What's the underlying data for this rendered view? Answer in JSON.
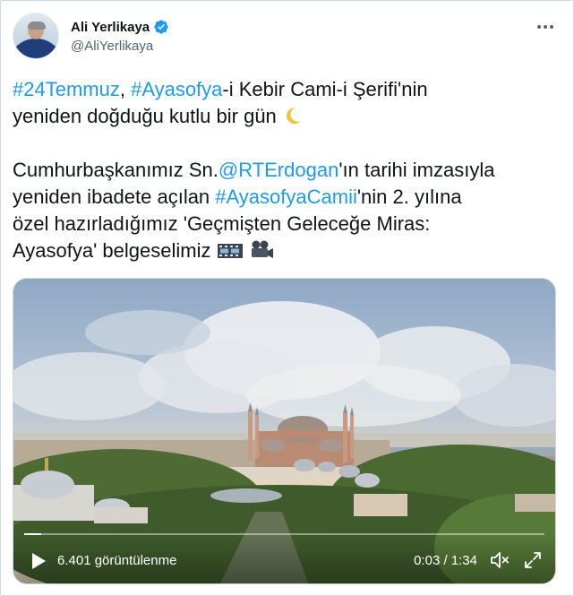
{
  "author": {
    "display_name": "Ali Yerlikaya",
    "handle": "@AliYerlikaya",
    "verified": true
  },
  "tweet": {
    "hashtag_1": "#24Temmuz",
    "sep_1": ", ",
    "hashtag_2": "#Ayasofya",
    "text_1": "-i Kebir Cami-i Şerifi'nin\nyeniden doğduğu kutlu bir gün ",
    "text_2": "\n\nCumhurbaşkanımız Sn.",
    "mention": "@RTErdogan",
    "text_3": "'ın tarihi imzasıyla\nyeniden ibadete açılan ",
    "hashtag_3": "#AyasofyaCamii",
    "text_4": "'nin 2. yılına\nözel hazırladığımız 'Geçmişten Geleceğe Miras:\nAyasofya' belgeselimiz ",
    "emojis": [
      "crescent-moon",
      "film-frames",
      "movie-camera"
    ]
  },
  "video": {
    "views_label": "6.401 görüntülenme",
    "time_label": "0:03 / 1:34",
    "progress_fraction": 0.032
  },
  "colors": {
    "link": "#1d9bf0",
    "verified": "#1d9bf0",
    "text": "#0f1419",
    "secondary": "#536471"
  }
}
